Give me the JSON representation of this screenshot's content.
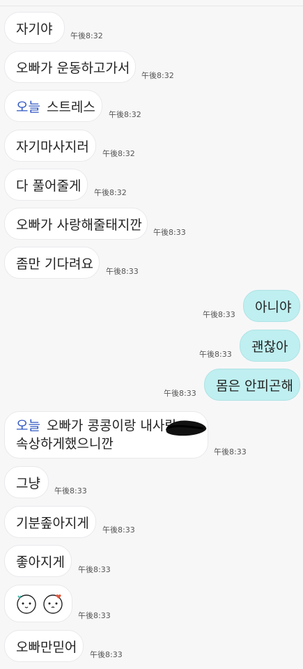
{
  "messages": [
    {
      "text": "자기야",
      "time": "午後8:32"
    },
    {
      "text": "오빠가 운동하고가서",
      "time": "午後8:32"
    },
    {
      "prefix": "오늘",
      "text": "스트레스",
      "time": "午後8:32"
    },
    {
      "text": "자기마사지러",
      "time": "午後8:32"
    },
    {
      "text": "다 풀어줄게",
      "time": "午後8:32"
    },
    {
      "text": "오빠가 사랑해줄태지깐",
      "time": "午後8:33"
    },
    {
      "text": "좀만 기다려요",
      "time": "午後8:33"
    },
    {
      "text": "아니야",
      "time": "午後8:33"
    },
    {
      "text": "괜찮아",
      "time": "午後8:33"
    },
    {
      "text": "몸은 안피곤해",
      "time": "午後8:33"
    },
    {
      "prefix": "오늘",
      "text": "오빠가 콩콩이랑 내사랑",
      "text2": "속상하게했으니깐",
      "time": "午後8:33"
    },
    {
      "text": "그냥",
      "time": "午後8:33"
    },
    {
      "text": "기분좊아지게",
      "time": "午後8:33"
    },
    {
      "text": "좋아지게",
      "time": "午後8:33"
    },
    {
      "emoji": "sticker-faces",
      "time": "午後8:33"
    },
    {
      "text": "오빠만믿어",
      "time": "午後8:33"
    }
  ],
  "colors": {
    "incoming": "#ffffff",
    "outgoing": "#bfeff0",
    "highlight": "#2f57c4"
  }
}
